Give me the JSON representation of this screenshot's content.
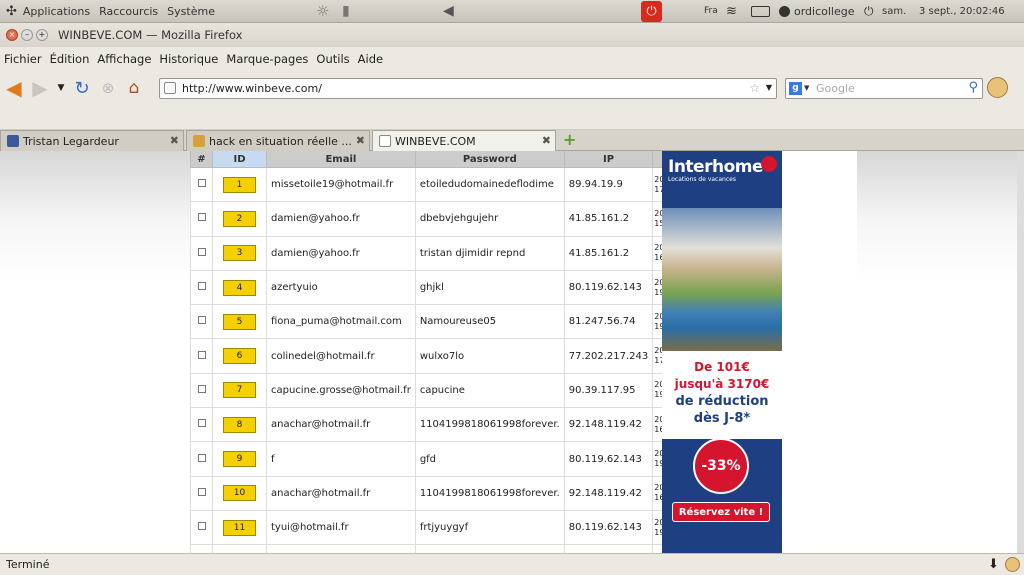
{
  "top_panel": {
    "menus": [
      "Applications",
      "Raccourcis",
      "Système"
    ],
    "keyboard": "Fra",
    "user": "ordicollege",
    "clock": "sam.    3 sept., 20:02:46"
  },
  "window": {
    "title": "WINBEVE.COM — Mozilla Firefox"
  },
  "menubar": [
    "Fichier",
    "Édition",
    "Affichage",
    "Historique",
    "Marque-pages",
    "Outils",
    "Aide"
  ],
  "address": {
    "url": "http://www.winbeve.com/"
  },
  "search": {
    "placeholder": "Google"
  },
  "tabs": [
    {
      "label": "Tristan Legardeur"
    },
    {
      "label": "hack en situation réelle ..."
    },
    {
      "label": "WINBEVE.COM"
    }
  ],
  "table": {
    "headers": [
      "#",
      "ID",
      "Email",
      "Password",
      "IP"
    ],
    "rows": [
      {
        "id": "1",
        "email": "missetoile19@hotmail.fr",
        "password": "etoiledudomainedeflodime",
        "ip": "89.94.19.9",
        "date": "20\n17"
      },
      {
        "id": "2",
        "email": "damien@yahoo.fr",
        "password": "dbebvjehgujehr",
        "ip": "41.85.161.2",
        "date": "20\n15"
      },
      {
        "id": "3",
        "email": "damien@yahoo.fr",
        "password": "tristan djimidir repnd",
        "ip": "41.85.161.2",
        "date": "20\n16"
      },
      {
        "id": "4",
        "email": "azertyuio",
        "password": "ghjkl",
        "ip": "80.119.62.143",
        "date": "20\n19"
      },
      {
        "id": "5",
        "email": "fiona_puma@hotmail.com",
        "password": "Namoureuse05",
        "ip": "81.247.56.74",
        "date": "20\n19"
      },
      {
        "id": "6",
        "email": "colinedel@hotmail.fr",
        "password": "wulxo7lo",
        "ip": "77.202.217.243",
        "date": "20\n17"
      },
      {
        "id": "7",
        "email": "capucine.grosse@hotmail.fr",
        "password": "capucine",
        "ip": "90.39.117.95",
        "date": "20\n19"
      },
      {
        "id": "8",
        "email": "anachar@hotmail.fr",
        "password": "1104199818061998forever.",
        "ip": "92.148.119.42",
        "date": "20\n16"
      },
      {
        "id": "9",
        "email": "f",
        "password": "gfd",
        "ip": "80.119.62.143",
        "date": "20\n19"
      },
      {
        "id": "10",
        "email": "anachar@hotmail.fr",
        "password": "1104199818061998forever.",
        "ip": "92.148.119.42",
        "date": "20\n16"
      },
      {
        "id": "11",
        "email": "tyui@hotmail.fr",
        "password": "frtjyuygyf",
        "ip": "80.119.62.143",
        "date": "20\n19"
      }
    ]
  },
  "ad": {
    "brand": "Interhome",
    "tagline": "Locations de vacances",
    "line1": "De 101€",
    "line2": "jusqu'à 3170€",
    "line3": "de réduction",
    "line4": "dès J-8*",
    "discount": "-33%",
    "cta": "Réservez vite !"
  },
  "status": {
    "text": "Terminé"
  }
}
